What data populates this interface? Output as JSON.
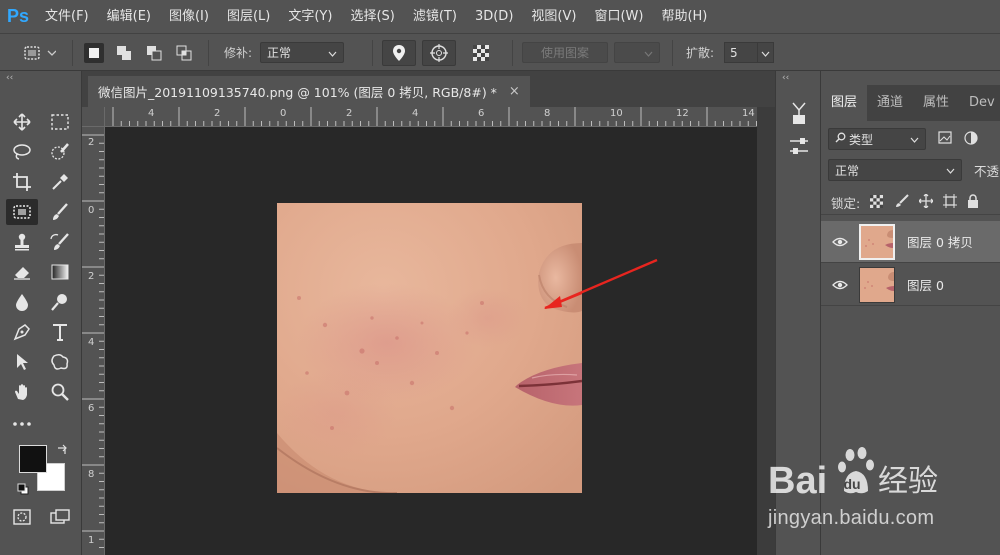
{
  "app": {
    "logo": "Ps"
  },
  "menu": [
    "文件(F)",
    "编辑(E)",
    "图像(I)",
    "图层(L)",
    "文字(Y)",
    "选择(S)",
    "滤镜(T)",
    "3D(D)",
    "视图(V)",
    "窗口(W)",
    "帮助(H)"
  ],
  "options": {
    "patch_label": "修补:",
    "patch_mode": "正常",
    "use_pattern": "使用图案",
    "diffusion_label": "扩散:",
    "diffusion_value": "5"
  },
  "document": {
    "tab_title": "微信图片_20191109135740.png @ 101% (图层 0 拷贝, RGB/8#) *",
    "close_glyph": "×"
  },
  "rulers": {
    "top": [
      "4",
      "2",
      "0",
      "2",
      "4",
      "6",
      "8",
      "10",
      "12",
      "14"
    ],
    "left": [
      "2",
      "0",
      "2",
      "4",
      "6",
      "8",
      "1"
    ]
  },
  "layers_panel": {
    "tabs": [
      "图层",
      "通道",
      "属性",
      "Dev"
    ],
    "filter_kind": "类型",
    "blend_mode": "正常",
    "opacity_label": "不透",
    "lock_label": "锁定:",
    "layers": [
      {
        "name": "图层 0 拷贝",
        "selected": true,
        "visible": true
      },
      {
        "name": "图层 0",
        "selected": false,
        "visible": true
      }
    ]
  },
  "colors": {
    "accent": "#31a8ff",
    "panel": "#535353",
    "canvas": "#282828",
    "annotation_arrow": "#e8251f",
    "foreground_swatch": "#111111",
    "background_swatch": "#ffffff"
  },
  "watermark": {
    "text": "jingyan.baidu.com",
    "logo_text": "Bai",
    "logo_text_2": "经验"
  }
}
